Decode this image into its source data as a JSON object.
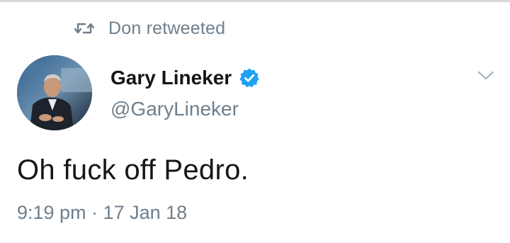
{
  "retweet": {
    "icon": "retweet-icon",
    "text": "Don retweeted"
  },
  "author": {
    "display_name": "Gary Lineker",
    "handle": "@GaryLineker",
    "verified": true,
    "avatar_icon": "avatar-photo"
  },
  "tweet": {
    "text": "Oh fuck off Pedro.",
    "timestamp": "9:19 pm · 17 Jan 18"
  },
  "menu": {
    "icon": "chevron-down-icon"
  },
  "colors": {
    "primary_text": "#14171a",
    "secondary_text": "#6f7f8c",
    "verified_blue": "#1da1f2"
  }
}
